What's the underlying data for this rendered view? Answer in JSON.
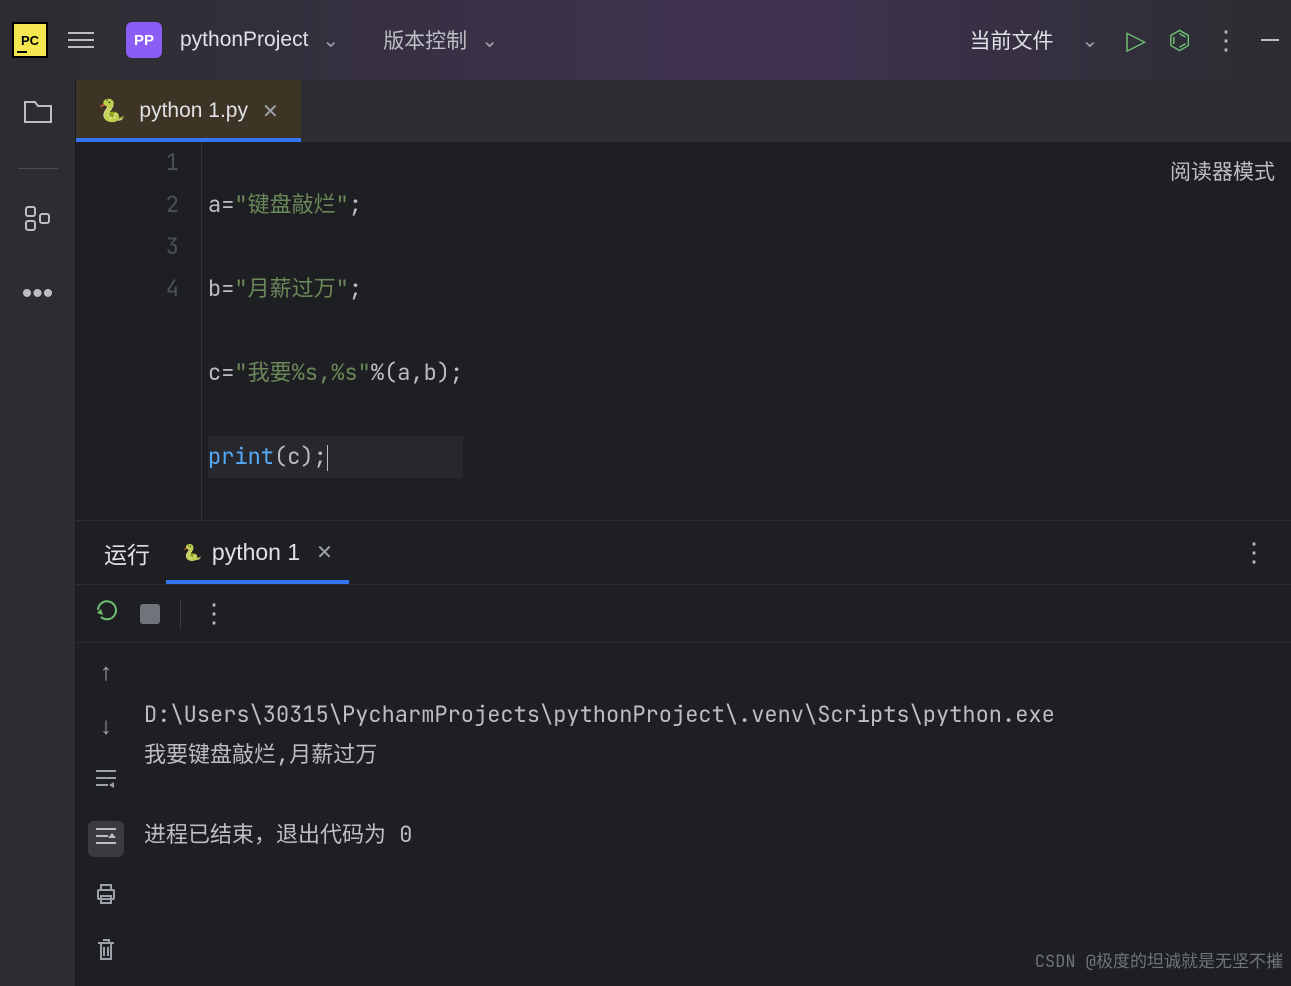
{
  "titlebar": {
    "logo_text": "PC",
    "project_badge": "PP",
    "project_name": "pythonProject",
    "vcs_label": "版本控制",
    "runconfig": "当前文件"
  },
  "editor_tab": {
    "filename": "python 1.py",
    "icon": "🐍"
  },
  "gutter": {
    "lines": [
      "1",
      "2",
      "3",
      "4"
    ]
  },
  "code": {
    "line1": {
      "var": "a",
      "eq": "=",
      "str": "\"键盘敲烂\"",
      "semi": ";"
    },
    "line2": {
      "var": "b",
      "eq": "=",
      "str": "\"月薪过万\"",
      "semi": ";"
    },
    "line3": {
      "var": "c",
      "eq": "=",
      "str": "\"我要%s,%s\"",
      "op": "%",
      "paren_open": "(",
      "a": "a",
      "comma": ",",
      "b": "b",
      "paren_close": ")",
      "semi": ";"
    },
    "line4": {
      "fn": "print",
      "paren_open": "(",
      "arg": "c",
      "paren_close": ")",
      "semi": ";"
    }
  },
  "reader_mode": "阅读器模式",
  "run": {
    "label": "运行",
    "tab_icon": "🐍",
    "tab_name": "python 1"
  },
  "console": {
    "path": "D:\\Users\\30315\\PycharmProjects\\pythonProject\\.venv\\Scripts\\python.exe",
    "output": "我要键盘敲烂,月薪过万",
    "exit_prefix": "进程已结束，退出代码为 ",
    "exit_code": "0"
  },
  "watermark": "CSDN @极度的坦诚就是无坚不摧"
}
